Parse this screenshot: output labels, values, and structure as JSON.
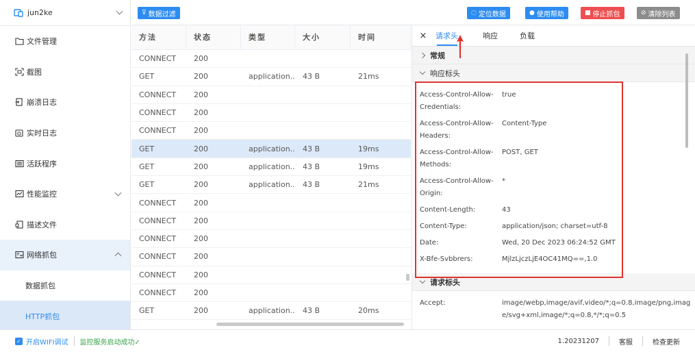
{
  "sidebar": {
    "device_name": "jun2ke",
    "items": [
      {
        "label": "文件管理",
        "icon": "folder-icon"
      },
      {
        "label": "截图",
        "icon": "screenshot-icon"
      },
      {
        "label": "崩溃日志",
        "icon": "crash-log-icon"
      },
      {
        "label": "实时日志",
        "icon": "realtime-log-icon"
      },
      {
        "label": "活跃程序",
        "icon": "app-list-icon"
      },
      {
        "label": "性能监控",
        "icon": "performance-icon"
      },
      {
        "label": "描述文件",
        "icon": "profile-icon"
      },
      {
        "label": "网络抓包",
        "icon": "network-icon"
      },
      {
        "label": "数据抓包",
        "icon": ""
      },
      {
        "label": "HTTP抓包",
        "icon": ""
      }
    ]
  },
  "toolbar": {
    "filter_label": "数据过滤",
    "locate_label": "定位数据",
    "help_label": "使用帮助",
    "stop_label": "停止抓包",
    "clear_label": "清除列表"
  },
  "colors": {
    "primary": "#2d8cf0",
    "danger": "#ed4f51",
    "muted": "#8c8c8c",
    "highlight_border": "#e0342f",
    "success": "#39a24a"
  },
  "table": {
    "columns": [
      "方法",
      "状态",
      "类型",
      "大小",
      "时间"
    ],
    "rows": [
      [
        "CONNECT",
        "200",
        "",
        "",
        ""
      ],
      [
        "GET",
        "200",
        "application...",
        "43 B",
        "21ms"
      ],
      [
        "CONNECT",
        "200",
        "",
        "",
        ""
      ],
      [
        "CONNECT",
        "200",
        "",
        "",
        ""
      ],
      [
        "CONNECT",
        "200",
        "",
        "",
        ""
      ],
      [
        "GET",
        "200",
        "application...",
        "43 B",
        "19ms"
      ],
      [
        "GET",
        "200",
        "application...",
        "43 B",
        "19ms"
      ],
      [
        "GET",
        "200",
        "application...",
        "43 B",
        "21ms"
      ],
      [
        "CONNECT",
        "200",
        "",
        "",
        ""
      ],
      [
        "CONNECT",
        "200",
        "",
        "",
        ""
      ],
      [
        "CONNECT",
        "200",
        "",
        "",
        ""
      ],
      [
        "CONNECT",
        "200",
        "",
        "",
        ""
      ],
      [
        "CONNECT",
        "200",
        "",
        "",
        ""
      ],
      [
        "CONNECT",
        "200",
        "",
        "",
        ""
      ],
      [
        "GET",
        "200",
        "application...",
        "43 B",
        "20ms"
      ]
    ]
  },
  "detail": {
    "close": "×",
    "tabs": [
      "请求头",
      "响应",
      "负载"
    ],
    "section_general": "常规",
    "section_response": "响应标头",
    "section_request": "请求标头",
    "response_headers": [
      {
        "key": "Access-Control-Allow-Credentials:",
        "value": "true"
      },
      {
        "key": "Access-Control-Allow-Headers:",
        "value": "Content-Type"
      },
      {
        "key": "Access-Control-Allow-Methods:",
        "value": "POST, GET"
      },
      {
        "key": "Access-Control-Allow-Origin:",
        "value": "*"
      },
      {
        "key": "Content-Length:",
        "value": "43"
      },
      {
        "key": "Content-Type:",
        "value": "application/json; charset=utf-8"
      },
      {
        "key": "Date:",
        "value": "Wed, 20 Dec 2023 06:24:52 GMT"
      },
      {
        "key": "X-Bfe-Svbbrers:",
        "value": "MjlzLjczLjE4OC41MQ==,1.0"
      }
    ],
    "request_headers": [
      {
        "key": "Accept:",
        "value": "image/webp,image/avif,video/*;q=0.8,image/png,image/svg+xml,image/*;q=0.8,*/*;q=0.5"
      }
    ]
  },
  "statusbar": {
    "wifi_label": "开启WIFI调试",
    "service_status": "监控服务启动成功✓",
    "version": "1.20231207",
    "support": "客服",
    "update": "检查更新"
  }
}
